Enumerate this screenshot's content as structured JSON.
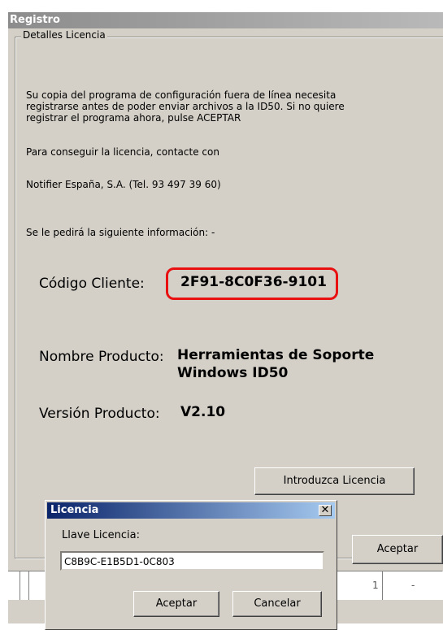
{
  "window": {
    "title": "Registro"
  },
  "group": {
    "legend": "Detalles Licencia"
  },
  "intro": {
    "line1": "Su copia del programa de configuración fuera de línea necesita",
    "line2": "registrarse antes de poder enviar archivos a la ID50. Si no quiere",
    "line3": "registrar el programa ahora, pulse ACEPTAR"
  },
  "contact": {
    "label": "Para conseguir la licencia, contacte con",
    "company": "Notifier España, S.A. (Tel. 93 497 39 60)"
  },
  "info_prompt": "Se le pedirá la siguiente información: -",
  "client": {
    "label": "Código Cliente:",
    "value": "2F91-8C0F36-9101"
  },
  "product_name": {
    "label": "Nombre Producto:",
    "value_line1": "Herramientas de Soporte",
    "value_line2": "Windows ID50"
  },
  "product_version": {
    "label": "Versión Producto:",
    "value": "V2.10"
  },
  "buttons": {
    "introduce_license": "Introduzca Licencia",
    "accept": "Aceptar"
  },
  "status_row": {
    "cell_number": "1",
    "cell_dash": "-"
  },
  "license_dialog": {
    "title": "Licencia",
    "close_glyph": "✕",
    "key_label": "Llave Licencia:",
    "key_value": "C8B9C-E1B5D1-0C803",
    "accept_label": "Aceptar",
    "cancel_label": "Cancelar"
  },
  "colors": {
    "highlight": "#e81010",
    "dialog_title": "#0a246a",
    "inactive_title": "#8c8c8c"
  }
}
